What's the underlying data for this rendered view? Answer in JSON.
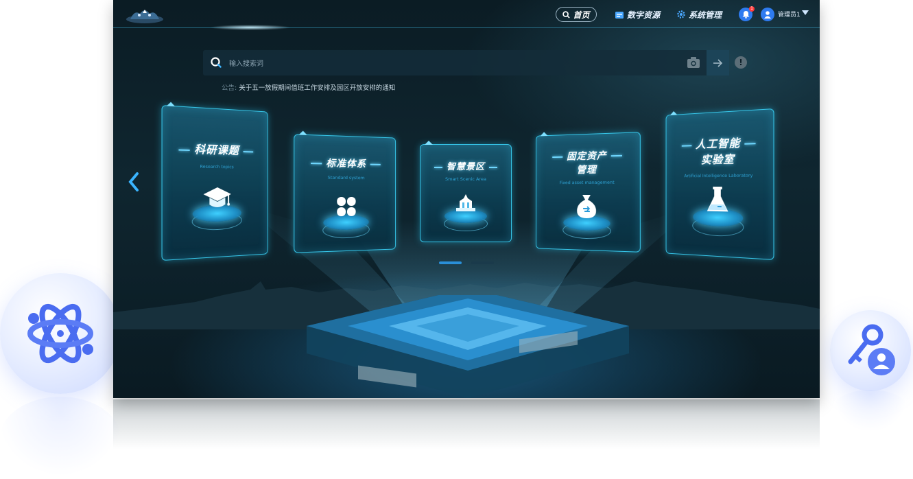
{
  "nav": {
    "home": "首页",
    "resources": "数字资源",
    "system": "系统管理",
    "notification_count": "1",
    "user": "管理员1"
  },
  "search": {
    "placeholder": "输入搜索词"
  },
  "notice": {
    "label": "公告:",
    "text": "关于五一放假期间值班工作安排及园区开放安排的通知"
  },
  "cards": [
    {
      "title_lines": [
        "科研课题"
      ],
      "subtitle": "Research topics",
      "icon": "graduation-cap-icon"
    },
    {
      "title_lines": [
        "标准体系"
      ],
      "subtitle": "Standard system",
      "icon": "clover-grid-icon"
    },
    {
      "title_lines": [
        "智慧景区"
      ],
      "subtitle": "Smart Scenic Area",
      "icon": "landmark-icon"
    },
    {
      "title_lines": [
        "固定资产",
        "管理"
      ],
      "subtitle": "Fixed asset management",
      "icon": "money-bag-icon"
    },
    {
      "title_lines": [
        "人工智能",
        "实验室"
      ],
      "subtitle": "Artificial Intelligence Laboratory",
      "icon": "flask-icon"
    }
  ],
  "pagination": {
    "pages": 2,
    "active": 1
  },
  "colors": {
    "accent": "#2e7bf0",
    "card_border": "#36c5e8",
    "background": "#0f2630"
  }
}
